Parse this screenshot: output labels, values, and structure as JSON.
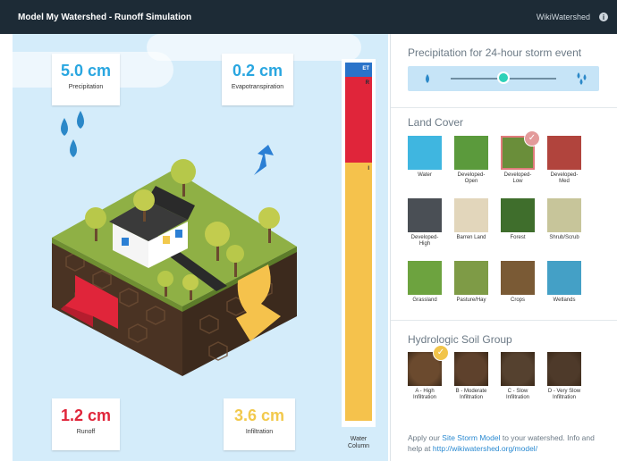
{
  "titlebar": {
    "app_title": "Model My Watershed - Runoff Simulation",
    "wiki_link": "WikiWatershed",
    "info_glyph": "i"
  },
  "scene": {
    "precipitation": {
      "value": "5.0 cm",
      "label": "Precipitation",
      "color": "#29a6e0"
    },
    "evapotranspiration": {
      "value": "0.2 cm",
      "label": "Evapotranspiration",
      "color": "#29a6e0"
    },
    "runoff": {
      "value": "1.2 cm",
      "label": "Runoff",
      "color": "#e0253a"
    },
    "infiltration": {
      "value": "3.6 cm",
      "label": "Infiltration",
      "color": "#f2c94c"
    }
  },
  "water_column": {
    "label_line1": "Water",
    "label_line2": "Column",
    "segments": [
      {
        "name": "ET",
        "label": "ET",
        "fraction": 0.04,
        "color": "#2a73c9"
      },
      {
        "name": "R",
        "label": "R",
        "fraction": 0.24,
        "color": "#e0253a"
      },
      {
        "name": "I",
        "label": "I",
        "fraction": 0.72,
        "color": "#f5c24c"
      }
    ]
  },
  "panel": {
    "precip_title": "Precipitation for 24-hour storm event",
    "precip_slider_fraction": 0.5,
    "landcover_title": "Land Cover",
    "land_cover": [
      {
        "label": "Water",
        "color": "#3fb6e0",
        "selected": false
      },
      {
        "label": "Developed-Open",
        "color": "#5b9a3c",
        "selected": false
      },
      {
        "label": "Developed-Low",
        "color": "#6a8e3a",
        "selected": true
      },
      {
        "label": "Developed-Med",
        "color": "#b1443d",
        "selected": false
      },
      {
        "label": "Developed-High",
        "color": "#4a4f55",
        "selected": false
      },
      {
        "label": "Barren Land",
        "color": "#e2d6bb",
        "selected": false
      },
      {
        "label": "Forest",
        "color": "#3f6e2c",
        "selected": false
      },
      {
        "label": "Shrub/Scrub",
        "color": "#c7c59a",
        "selected": false
      },
      {
        "label": "Grassland",
        "color": "#6da33f",
        "selected": false
      },
      {
        "label": "Pasture/Hay",
        "color": "#7e9b46",
        "selected": false
      },
      {
        "label": "Crops",
        "color": "#7a5a35",
        "selected": false
      },
      {
        "label": "Wetlands",
        "color": "#44a0c6",
        "selected": false
      }
    ],
    "soil_title": "Hydrologic Soil Group",
    "soil_groups": [
      {
        "label": "A - High Infiltration",
        "color": "#6b4a2e",
        "selected": true
      },
      {
        "label": "B - Moderate Infiltration",
        "color": "#5e412c",
        "selected": false
      },
      {
        "label": "C - Slow Infiltration",
        "color": "#55412f",
        "selected": false
      },
      {
        "label": "D - Very Slow Infiltration",
        "color": "#4e3a2a",
        "selected": false
      }
    ],
    "footer_prefix": "Apply our ",
    "footer_link1": "Site Storm Model",
    "footer_middle": " to your watershed. Info and help at ",
    "footer_link2": "http://wikiwatershed.org/model/"
  }
}
